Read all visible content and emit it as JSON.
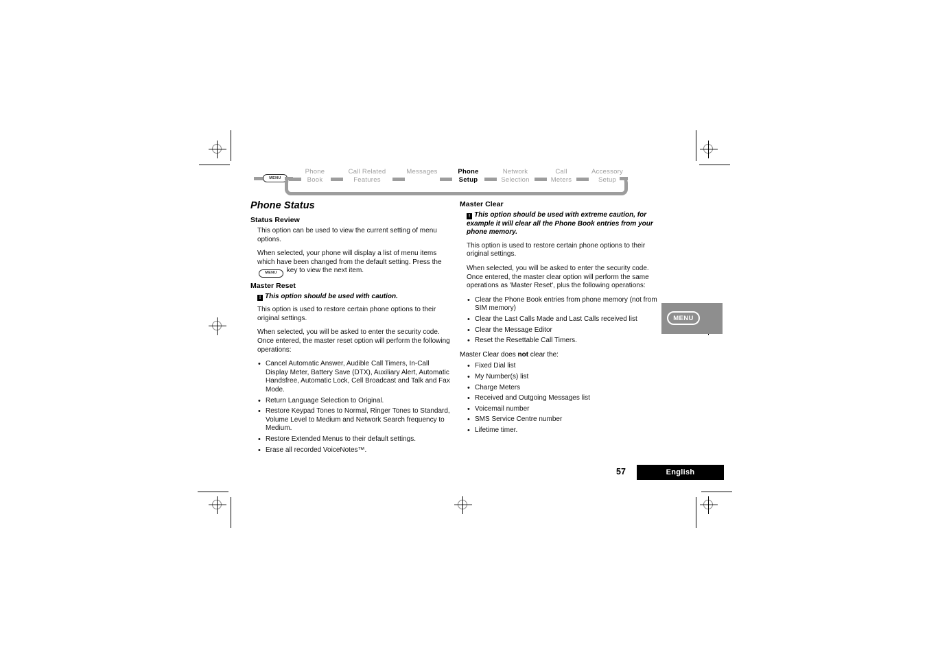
{
  "document": {
    "page_number": "57",
    "language_label": "English"
  },
  "navmap": {
    "menu_chip_label": "MENU",
    "items": [
      {
        "lines": [
          "Phone",
          "Book"
        ],
        "current": false
      },
      {
        "lines": [
          "Call Related",
          "Features"
        ],
        "current": false
      },
      {
        "lines": [
          "Messages",
          ""
        ],
        "current": false
      },
      {
        "lines": [
          "Phone",
          "Setup"
        ],
        "current": true
      },
      {
        "lines": [
          "Network",
          "Selection"
        ],
        "current": false
      },
      {
        "lines": [
          "Call",
          "Meters"
        ],
        "current": false
      },
      {
        "lines": [
          "Accessory",
          "Setup"
        ],
        "current": false
      }
    ]
  },
  "side_tab": {
    "label": "MENU"
  },
  "left_column": {
    "section_title": "Phone Status",
    "status_review": {
      "heading": "Status Review",
      "paragraph_1": "This option can be used to view the current setting of menu options.",
      "paragraph_2_before_key": "When selected, your phone will display a list of menu items which have been changed from the default setting. Press the",
      "inline_key_label": "MENU",
      "paragraph_2_after_key": "key to view the next item."
    },
    "master_reset": {
      "heading": "Master Reset",
      "caution_icon": "warning-icon",
      "caution_text": "This option should be used with caution.",
      "paragraph_1": "This option is used to restore certain phone options to their original settings.",
      "paragraph_2": "When selected, you will be asked to enter the security code. Once entered, the master reset option will perform the following operations:",
      "bullets": [
        "Cancel Automatic Answer, Audible Call Timers, In-Call Display Meter, Battery Save (DTX), Auxiliary Alert, Automatic Handsfree, Automatic Lock, Cell Broadcast and Talk and Fax Mode.",
        "Return Language Selection to Original.",
        "Restore Keypad Tones to Normal, Ringer Tones to Standard, Volume Level to Medium and Network Search frequency to Medium.",
        "Restore Extended Menus to their default settings.",
        "Erase all recorded VoiceNotes™."
      ]
    }
  },
  "right_column": {
    "master_clear": {
      "heading": "Master Clear",
      "caution_icon": "warning-icon",
      "caution_text": "This option should be used with extreme caution, for example it will clear all the Phone Book entries from your phone memory.",
      "paragraph_1": "This option is used to restore certain phone options to their original settings.",
      "paragraph_2": "When selected, you will be asked to enter the security code. Once entered, the master clear option will perform the same operations as 'Master Reset', plus the following operations:",
      "bullets_does": [
        "Clear the Phone Book entries from phone memory (not from SIM memory)",
        "Clear the Last Calls Made and Last Calls received list",
        "Clear the Message Editor",
        "Reset the Resettable Call Timers."
      ],
      "not_lead_before": "Master Clear does ",
      "not_lead_bold": "not",
      "not_lead_after": " clear the:",
      "bullets_not": [
        "Fixed Dial list",
        "My Number(s) list",
        "Charge Meters",
        "Received and Outgoing Messages list",
        "Voicemail number",
        "SMS Service Centre number",
        "Lifetime timer."
      ]
    }
  },
  "colors": {
    "nav_gray": "#9d9d9d",
    "tab_gray": "#8e8e8e",
    "text_black": "#000000",
    "footer_bar": "#000000"
  }
}
